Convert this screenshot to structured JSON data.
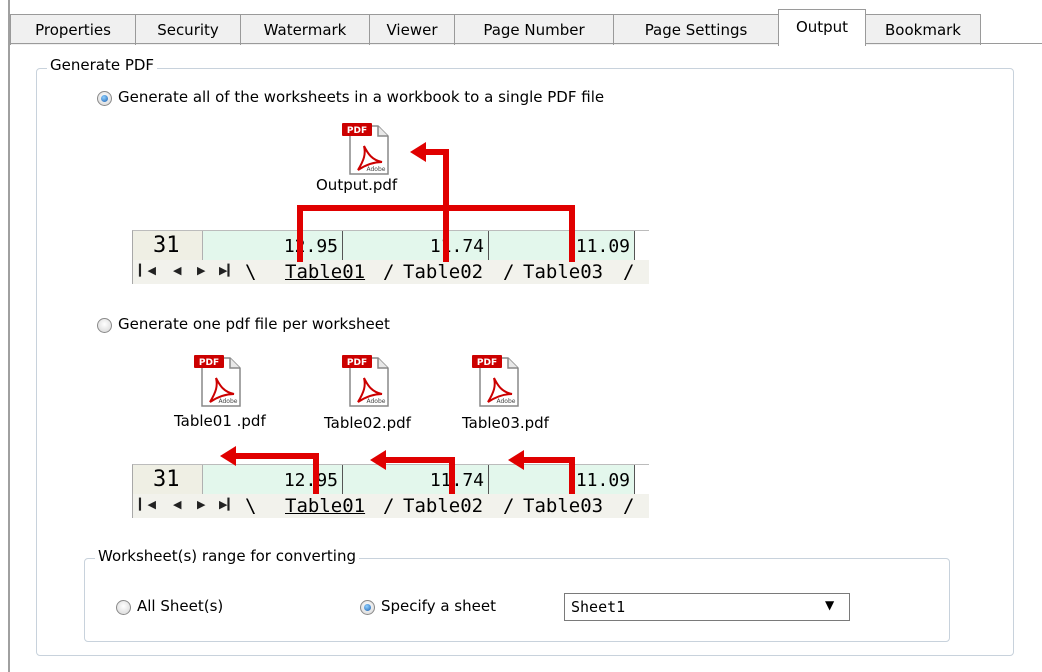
{
  "tabs": [
    {
      "label": "Properties"
    },
    {
      "label": "Security"
    },
    {
      "label": "Watermark"
    },
    {
      "label": "Viewer"
    },
    {
      "label": "Page Number"
    },
    {
      "label": "Page Settings"
    },
    {
      "label": "Output",
      "active": true
    },
    {
      "label": "Bookmark"
    }
  ],
  "generate_pdf": {
    "legend": "Generate PDF",
    "option_single": {
      "label": "Generate all of the worksheets in a workbook to a single PDF file",
      "checked": true
    },
    "single_output_caption": "Output.pdf",
    "option_per_sheet": {
      "label": "Generate one pdf file per worksheet",
      "checked": false
    },
    "per_sheet_captions": [
      "Table01 .pdf",
      "Table02.pdf",
      "Table03.pdf"
    ],
    "pdf_icon": {
      "badge": "PDF",
      "brand": "Adobe",
      "icon": "pdf-file-icon"
    },
    "sheet_preview": {
      "row_number": "31",
      "values": [
        "12.95",
        "11.74",
        "11.09"
      ],
      "sheet_tabs": [
        "Table01",
        "Table02",
        "Table03"
      ]
    }
  },
  "range": {
    "legend": "Worksheet(s) range for converting",
    "option_all": {
      "label": "All Sheet(s)",
      "checked": false
    },
    "option_specify": {
      "label": "Specify a sheet",
      "checked": true
    },
    "sheet_select": {
      "value": "Sheet1"
    }
  },
  "colors": {
    "arrow": "#e00000",
    "pdf_badge": "#cc0000",
    "sheet_cells": "#e3f7ec"
  }
}
